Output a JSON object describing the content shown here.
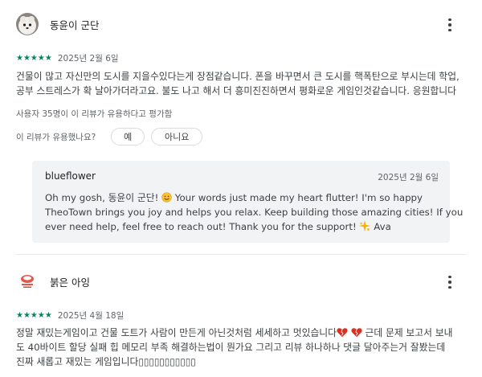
{
  "review1": {
    "author": "동윤이 군단",
    "stars": "★★★★★",
    "date": "2025년 2월 6일",
    "text_line1": "건물이 많고 자신만의 도시를 지을수있다는게 장점같습니다. 폰을 바꾸면서 큰 도시를 핵폭탄으로 부시는데 학업,",
    "text_line2": "공부 스트레스가 확 날아가더라고요. 불도 나고 해서 더 흥미진진하면서 평화로운 게임인것같습니다. 응원합니다",
    "helpful_count": "사용자 35명이 이 리뷰가 유용하다고 평가함",
    "helpful_question": "이 리뷰가 유용했나요?",
    "yes_label": "예",
    "no_label": "아니요"
  },
  "reply": {
    "author": "blueflower",
    "date": "2025년 2월 6일",
    "line1_a": "Oh my gosh, 동윤이 군단! ",
    "line1_b": " Your words just made my heart flutter! I'm so happy",
    "line2": "TheoTown brings you joy and helps you relax. Keep building those amazing cities! If you",
    "line3_a": "ever need help, feel free to reach out! Thank you for the support! ",
    "line3_b": " Ava"
  },
  "review2": {
    "author": "붉은 아잉",
    "stars": "★★★★★",
    "date": "2025년 4월 18일",
    "text_line1_a": "정말 재밌는게임이고 건물 도트가 사람이 만든게 아닌것처럼 세세하고 멋있습니다",
    "text_line1_b": " 근데 문제 보고서 보내",
    "text_line2": "도 40바이트 할당 실패 힙 메모리 부족 해결하는법이 뭔가요 그리고 리뷰 하나하나 댓글 달아주는거 잘봤는데",
    "text_line3": "진짜 새롭고 재밌는 게임입니다▯▯▯▯▯▯▯▯▯▯▯"
  },
  "colors": {
    "star_green": "#01875f",
    "reply_bg": "#f1f3f4",
    "heart_red": "#d93025"
  },
  "icons": {
    "more": "more-vert-icon",
    "smile": "smiling-face-emoji",
    "sparkle": "sparkle-emoji",
    "heart": "broken-heart-emoji"
  }
}
